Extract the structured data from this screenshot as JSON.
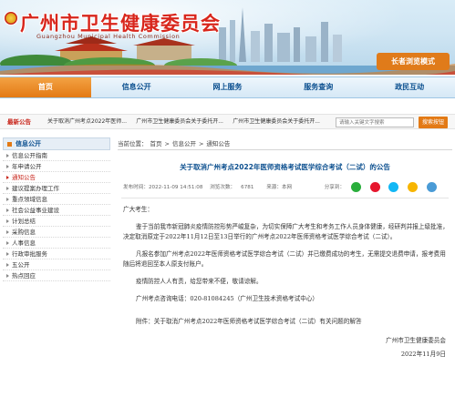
{
  "header": {
    "title": "广州市卫生健康委员会",
    "title_en": "Guangzhou Municipal Health Commission",
    "elder_mode": "长者浏览模式"
  },
  "nav": {
    "items": [
      {
        "label": "首页",
        "active": true
      },
      {
        "label": "信息公开",
        "active": false
      },
      {
        "label": "网上服务",
        "active": false
      },
      {
        "label": "服务查询",
        "active": false
      },
      {
        "label": "政民互动",
        "active": false
      }
    ]
  },
  "notice_bar": {
    "label": "最新公告",
    "items": [
      "关于取消广州考点2022年医师...",
      "广州市卫生健康委员会关于委托开...",
      "广州市卫生健康委员会关于委托开..."
    ],
    "search_placeholder": "请输入关键文字搜索",
    "search_button": "搜索按钮"
  },
  "sidebar": {
    "heading": "信息公开",
    "items": [
      {
        "label": "信息公开指南",
        "active": false
      },
      {
        "label": "年申请公开",
        "active": false
      },
      {
        "label": "通知公告",
        "active": true
      },
      {
        "label": "建议提案办理工作",
        "active": false
      },
      {
        "label": "重点领域信息",
        "active": false
      },
      {
        "label": "社会公益事业建设",
        "active": false
      },
      {
        "label": "计划总结",
        "active": false
      },
      {
        "label": "采购信息",
        "active": false
      },
      {
        "label": "人事信息",
        "active": false
      },
      {
        "label": "行政审批服务",
        "active": false
      },
      {
        "label": "五公开",
        "active": false
      },
      {
        "label": "热点回应",
        "active": false
      }
    ]
  },
  "breadcrumb": {
    "prefix": "当前位置：",
    "items": [
      "首页",
      "信息公开",
      "通知公告"
    ],
    "separator": ">"
  },
  "article": {
    "title": "关于取消广州考点2022年医师资格考试医学综合考试（二试）的公告",
    "meta": {
      "published": "发布时间：2022-11-09 14:51:08",
      "views": "浏览次数：",
      "views_count": "6781",
      "source": "来源：本网",
      "share_label": "分享到："
    },
    "paragraphs": [
      {
        "text": "广大考生：",
        "indent": false
      },
      {
        "text": "鉴于当前我市新冠肺炎疫情防控形势严峻复杂，为切实保障广大考生和考务工作人员身体健康，经研判并报上级批准，决定取消原定于2022年11月12日至13日举行的广州考点2022年医师资格考试医学综合考试（二试）。",
        "indent": true
      },
      {
        "text": "凡报名参加广州考点2022年医师资格考试医学综合考试（二试）并已缴费成功的考生，无需提交退费申请，报考费用随后将退回至本人原支付账户。",
        "indent": true
      },
      {
        "text": "疫情防控人人有责，给您带来不便，敬请谅解。",
        "indent": true
      },
      {
        "text": "广州考点咨询电话：020-81084245（广州卫生技术资格考试中心）",
        "indent": true
      },
      {
        "text": "附件：关于取消广州考点2022年医师资格考试医学综合考试（二试）有关问题的解答",
        "indent": true
      }
    ],
    "signature_org": "广州市卫生健康委员会",
    "signature_date": "2022年11月9日"
  },
  "colors": {
    "brand_red": "#d8261c",
    "accent_orange": "#e37a15",
    "link_blue": "#0b4f8f"
  }
}
